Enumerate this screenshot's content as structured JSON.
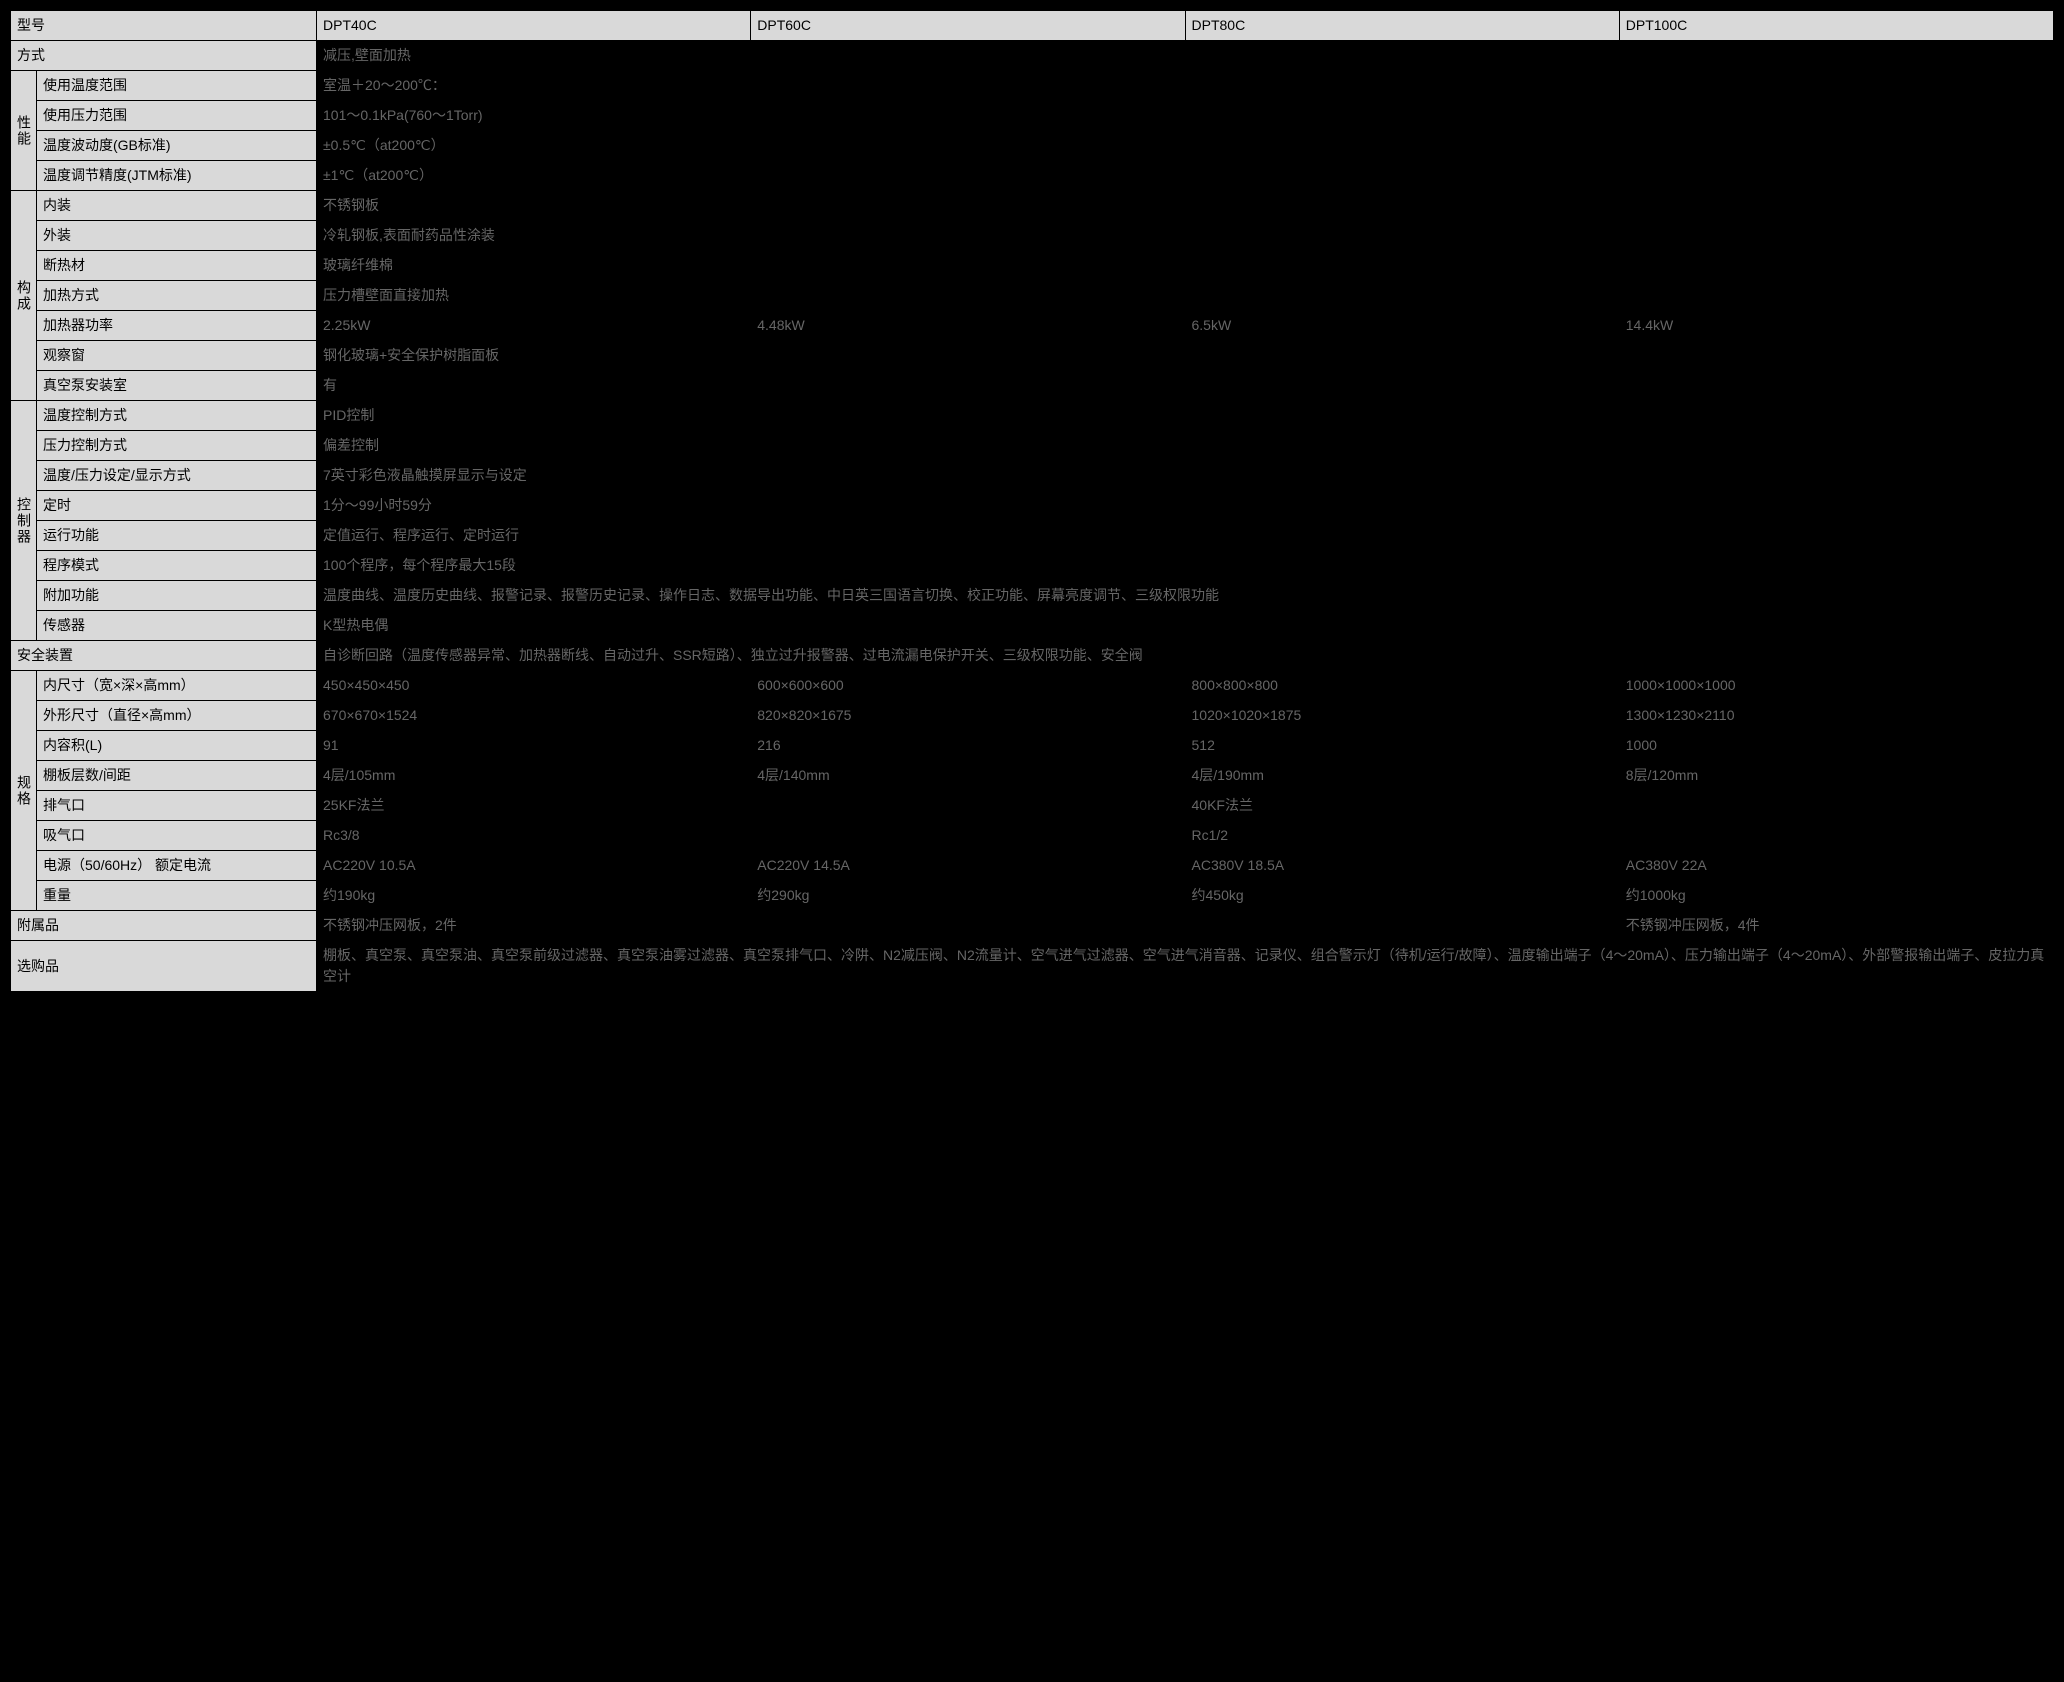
{
  "header": {
    "model_label": "型号",
    "models": [
      "DPT40C",
      "DPT60C",
      "DPT80C",
      "DPT100C"
    ]
  },
  "rows": {
    "method": {
      "label": "方式",
      "value": "减压,壁面加热"
    },
    "perf_label": "性能",
    "perf": {
      "temp_range": {
        "label": "使用温度范围",
        "value": "室温＋20～200℃："
      },
      "press_range": {
        "label": "使用压力范围",
        "value": "101～0.1kPa(760～1Torr)"
      },
      "temp_fluct": {
        "label": "温度波动度(GB标准)",
        "value": "±0.5℃（at200℃）"
      },
      "temp_adj": {
        "label": "温度调节精度(JTM标准)",
        "value": "±1℃（at200℃）"
      }
    },
    "struct_label": "构成",
    "struct": {
      "interior": {
        "label": "内装",
        "value": "不锈钢板"
      },
      "exterior": {
        "label": "外装",
        "value": "冷轧钢板,表面耐药品性涂装"
      },
      "insulation": {
        "label": "断热材",
        "value": "玻璃纤维棉"
      },
      "heat_method": {
        "label": "加热方式",
        "value": "压力槽壁面直接加热"
      },
      "heater_power": {
        "label": "加热器功率",
        "values": [
          "2.25kW",
          "4.48kW",
          "6.5kW",
          "14.4kW"
        ]
      },
      "window": {
        "label": "观察窗",
        "value": "钢化玻璃+安全保护树脂面板"
      },
      "pump_room": {
        "label": "真空泵安装室",
        "value": "有"
      }
    },
    "ctrl_label": "控制器",
    "ctrl": {
      "temp_ctrl": {
        "label": "温度控制方式",
        "value": "PID控制"
      },
      "press_ctrl": {
        "label": "压力控制方式",
        "value": "偏差控制"
      },
      "display": {
        "label": "温度/压力设定/显示方式",
        "value": "7英寸彩色液晶触摸屏显示与设定"
      },
      "timer": {
        "label": "定时",
        "value": "1分～99小时59分"
      },
      "run_func": {
        "label": "运行功能",
        "value": "定值运行、程序运行、定时运行"
      },
      "prog_mode": {
        "label": "程序模式",
        "value": "100个程序，每个程序最大15段"
      },
      "extra": {
        "label": "附加功能",
        "value": "温度曲线、温度历史曲线、报警记录、报警历史记录、操作日志、数据导出功能、中日英三国语言切换、校正功能、屏幕亮度调节、三级权限功能"
      },
      "sensor": {
        "label": "传感器",
        "value": "K型热电偶"
      }
    },
    "safety": {
      "label": "安全装置",
      "value": "自诊断回路（温度传感器异常、加热器断线、自动过升、SSR短路）、独立过升报警器、过电流漏电保护开关、三级权限功能、安全阀"
    },
    "spec_label": "规格",
    "spec": {
      "inner": {
        "label": "内尺寸（宽×深×高mm）",
        "values": [
          "450×450×450",
          "600×600×600",
          "800×800×800",
          "1000×1000×1000"
        ]
      },
      "outer": {
        "label": "外形尺寸（直径×高mm）",
        "values": [
          "670×670×1524",
          "820×820×1675",
          "1020×1020×1875",
          "1300×1230×2110"
        ]
      },
      "volume": {
        "label": "内容积(L)",
        "values": [
          "91",
          "216",
          "512",
          "1000"
        ]
      },
      "shelves": {
        "label": "棚板层数/间距",
        "values": [
          "4层/105mm",
          "4层/140mm",
          "4层/190mm",
          "8层/120mm"
        ]
      },
      "exhaust": {
        "label": "排气口",
        "values": [
          "25KF法兰",
          "40KF法兰"
        ]
      },
      "intake": {
        "label": "吸气口",
        "values": [
          "Rc3/8",
          "Rc1/2"
        ]
      },
      "power": {
        "label": "电源（50/60Hz） 额定电流",
        "values": [
          "AC220V 10.5A",
          "AC220V 14.5A",
          "AC380V 18.5A",
          "AC380V 22A"
        ]
      },
      "weight": {
        "label": "重量",
        "values": [
          "约190kg",
          "约290kg",
          "约450kg",
          "约1000kg"
        ]
      }
    },
    "accessories": {
      "label": "附属品",
      "values": [
        "不锈钢冲压网板，2件",
        "不锈钢冲压网板，4件"
      ]
    },
    "options": {
      "label": "选购品",
      "value": "棚板、真空泵、真空泵油、真空泵前级过滤器、真空泵油雾过滤器、真空泵排气口、冷阱、N2减压阀、N2流量计、空气进气过滤器、空气进气消音器、记录仪、组合警示灯（待机/运行/故障）、温度输出端子（4～20mA）、压力输出端子（4～20mA）、外部警报输出端子、皮拉力真空计"
    }
  }
}
